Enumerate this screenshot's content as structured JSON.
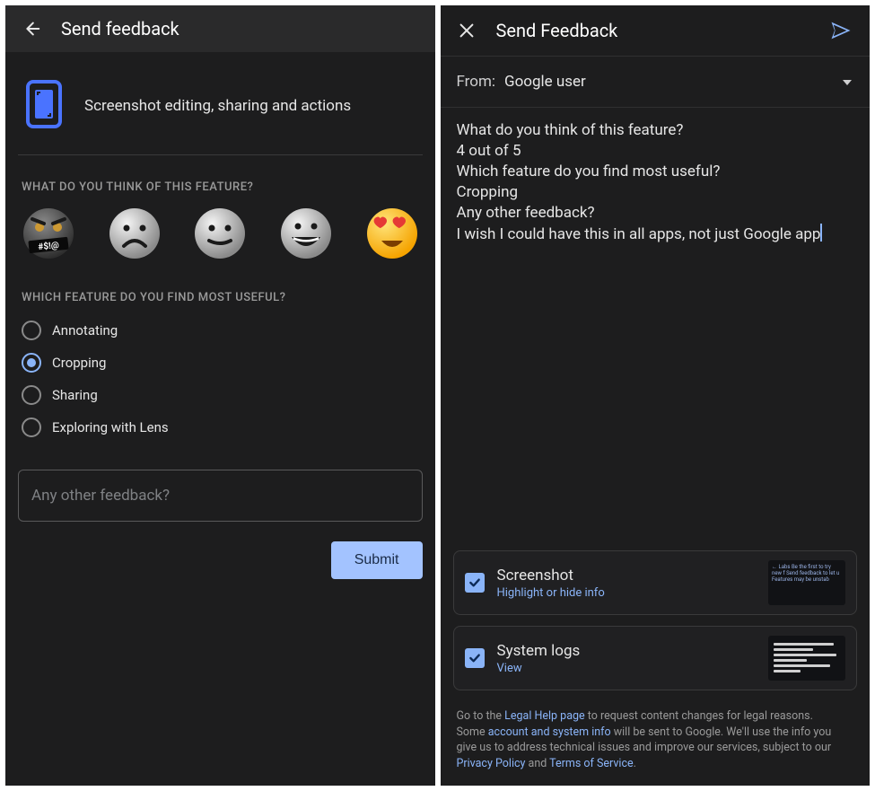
{
  "left": {
    "title": "Send feedback",
    "hero": "Screenshot editing, sharing and actions",
    "q1": "What do you think of this feature?",
    "q2": "Which feature do you find most useful?",
    "emojis": [
      {
        "name": "emoji-angry-censored",
        "label": "Very bad"
      },
      {
        "name": "emoji-frown",
        "label": "Bad"
      },
      {
        "name": "emoji-neutral",
        "label": "Okay"
      },
      {
        "name": "emoji-grin",
        "label": "Good"
      },
      {
        "name": "emoji-heart-eyes",
        "label": "Great"
      }
    ],
    "options": [
      {
        "label": "Annotating",
        "selected": false
      },
      {
        "label": "Cropping",
        "selected": true
      },
      {
        "label": "Sharing",
        "selected": false
      },
      {
        "label": "Exploring with Lens",
        "selected": false
      }
    ],
    "other_placeholder": "Any other feedback?",
    "submit": "Submit"
  },
  "right": {
    "title": "Send Feedback",
    "from_label": "From:",
    "from_value": "Google user",
    "message": "What do you think of this feature?\n4 out of 5\nWhich feature do you find most useful?\nCropping\nAny other feedback?\nI wish I could have this in all apps, not just Google app",
    "attachments": {
      "screenshot": {
        "title": "Screenshot",
        "sub": "Highlight or hide info",
        "checked": true,
        "thumb_text": "←   Labs\nBe the first to try new f\nSend feedback to let u\nFeatures may be unstab"
      },
      "syslogs": {
        "title": "System logs",
        "sub": "View",
        "checked": true
      }
    },
    "legal": {
      "t1": "Go to the ",
      "l1": "Legal Help page",
      "t2": " to request content changes for legal reasons.",
      "t3": "Some ",
      "l2": "account and system info",
      "t4": " will be sent to Google. We'll use the info you give us to address technical issues and improve our services, subject to our ",
      "l3": "Privacy Policy",
      "t5": " and ",
      "l4": "Terms of Service",
      "t6": "."
    }
  }
}
